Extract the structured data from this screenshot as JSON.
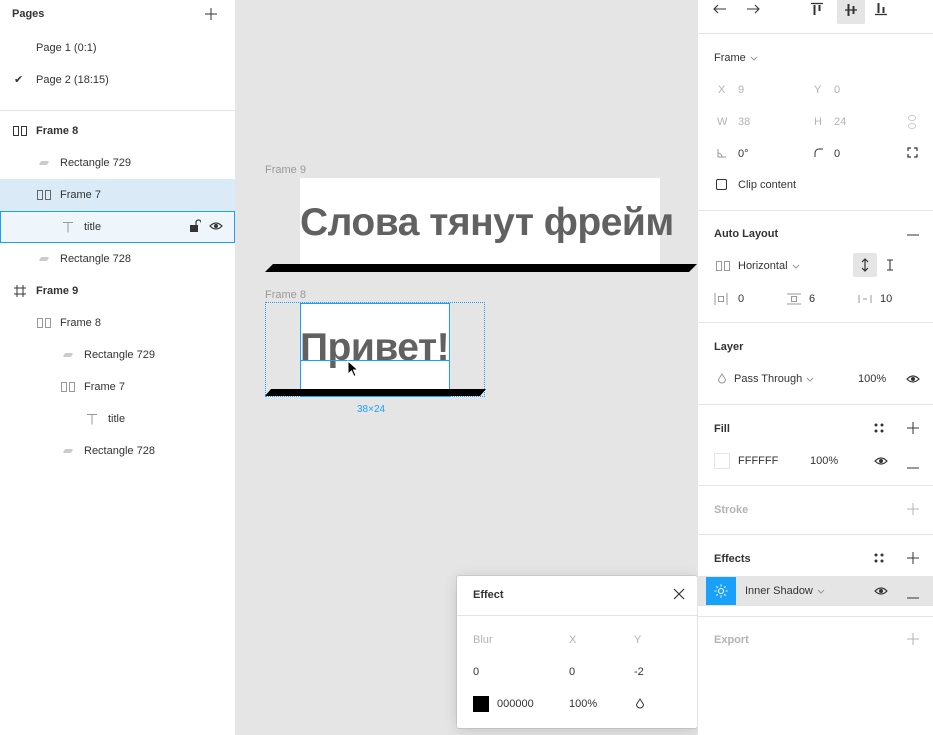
{
  "pages": {
    "title": "Pages",
    "items": [
      {
        "label": "Page 1 (0:1)",
        "checked": false
      },
      {
        "label": "Page 2 (18:15)",
        "checked": true
      }
    ]
  },
  "layers": [
    {
      "label": "Frame 8",
      "icon": "autolayout-icon",
      "depth": 0,
      "bold": true
    },
    {
      "label": "Rectangle 729",
      "icon": "rectangle-icon",
      "depth": 1
    },
    {
      "label": "Frame 7",
      "icon": "autolayout-icon",
      "depth": 1,
      "selected": true
    },
    {
      "label": "title",
      "icon": "text-icon",
      "depth": 2,
      "hovered": true
    },
    {
      "label": "Rectangle 728",
      "icon": "rectangle-icon",
      "depth": 1
    },
    {
      "label": "Frame 9",
      "icon": "frame-icon",
      "depth": 0,
      "bold": true
    },
    {
      "label": "Frame 8",
      "icon": "autolayout-icon",
      "depth": 1
    },
    {
      "label": "Rectangle 729",
      "icon": "rectangle-icon",
      "depth": 2
    },
    {
      "label": "Frame 7",
      "icon": "autolayout-icon",
      "depth": 2
    },
    {
      "label": "title",
      "icon": "text-icon",
      "depth": 3
    },
    {
      "label": "Rectangle 728",
      "icon": "rectangle-icon",
      "depth": 2
    }
  ],
  "canvas": {
    "frame9_label": "Frame 9",
    "frame9_text": "Слова тянут фрейм",
    "frame8_label": "Frame 8",
    "frame8_text": "Привет!",
    "size_badge": "38×24"
  },
  "design": {
    "frame_type": "Frame",
    "x_label": "X",
    "x": "9",
    "y_label": "Y",
    "y": "0",
    "w_label": "W",
    "w": "38",
    "h_label": "H",
    "h": "24",
    "rotation": "0°",
    "radius": "0",
    "clip_content": "Clip content",
    "auto_layout_title": "Auto Layout",
    "direction": "Horizontal",
    "padding_h": "0",
    "padding_v": "6",
    "spacing": "10",
    "layer_title": "Layer",
    "blend": "Pass Through",
    "layer_opacity": "100%",
    "fill_title": "Fill",
    "fill_hex": "FFFFFF",
    "fill_opacity": "100%",
    "stroke_title": "Stroke",
    "effects_title": "Effects",
    "effect_type": "Inner Shadow",
    "export_title": "Export"
  },
  "effect_popup": {
    "title": "Effect",
    "blur_label": "Blur",
    "x_label": "X",
    "y_label": "Y",
    "blur": "0",
    "x": "0",
    "y": "-2",
    "color_hex": "000000",
    "opacity": "100%"
  },
  "colors": {
    "accent": "#18a0fb",
    "selection": "#daebf7",
    "text_gray": "#616161"
  }
}
